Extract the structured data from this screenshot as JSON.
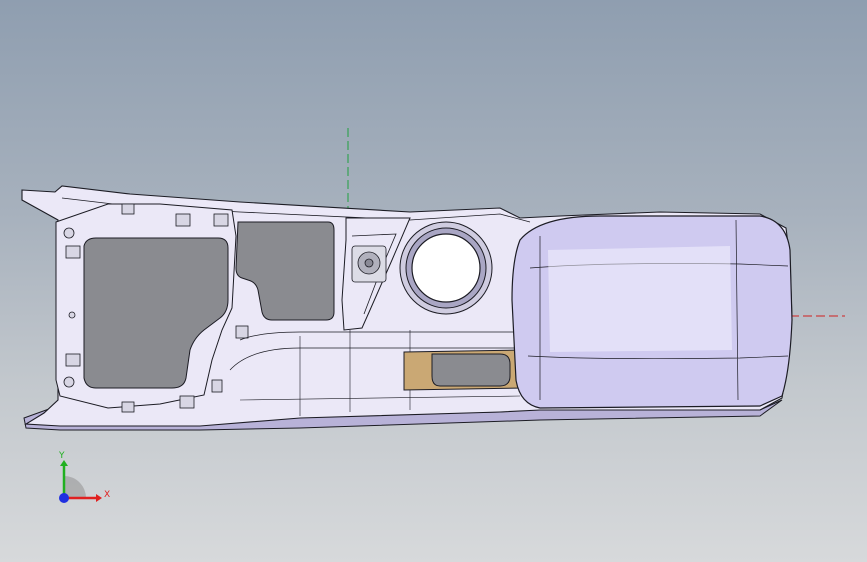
{
  "viewport": {
    "background_top": "#8f9eb0",
    "background_bottom": "#d7d9db"
  },
  "model": {
    "body_color": "#ebe8f7",
    "body_shadow_color": "#b8b2d8",
    "armrest_color": "#cfcaf0",
    "edge_color": "#1c1c24",
    "cavity_color": "#8a8b90",
    "cup_holder_color": "#ffffff",
    "tan_insert_color": "#caa874",
    "icons": [
      "cup-holder-icon",
      "usb-port-icon",
      "storage-bin-icon"
    ]
  },
  "triad": {
    "x_label": "X",
    "y_label": "Y",
    "x_color": "#e02020",
    "y_color": "#20b020",
    "z_color": "#2030e0",
    "origin_color": "#a0a0a0"
  },
  "reference_axes": {
    "vertical_color": "#20a040",
    "horizontal_color": "#d02020"
  }
}
